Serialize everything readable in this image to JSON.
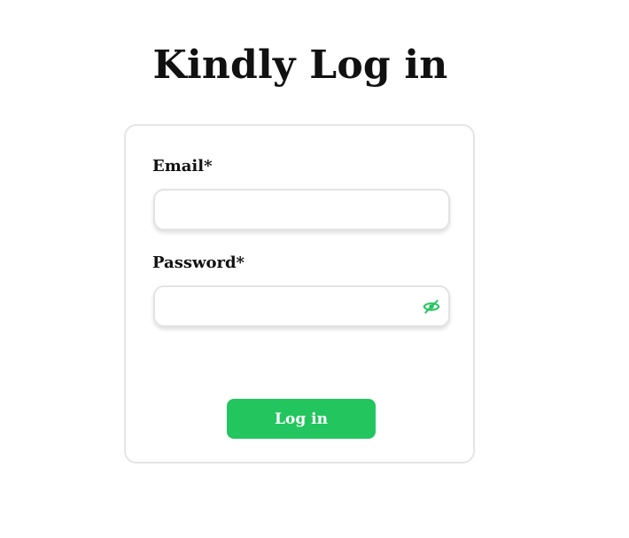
{
  "page": {
    "title": "Kindly Log in"
  },
  "form": {
    "email_label": "Email*",
    "email_value": "",
    "email_placeholder": "",
    "password_label": "Password*",
    "password_value": "",
    "password_placeholder": "",
    "password_toggle_icon": "eye-slash-icon",
    "submit_label": "Log in"
  },
  "colors": {
    "accent": "#22c55e",
    "card_border": "#e5e5e5",
    "text": "#111111"
  }
}
